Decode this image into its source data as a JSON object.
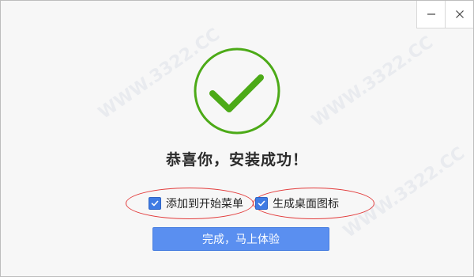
{
  "window": {
    "minimize_label": "—",
    "close_label": "✕"
  },
  "icons": {
    "success": "check-circle-icon",
    "checkbox": "checkmark-icon"
  },
  "colors": {
    "success_green": "#4caa17",
    "accent_blue": "#5a8ff0",
    "checkbox_blue": "#3f7be3",
    "annotation_red": "#e23a3a"
  },
  "main": {
    "headline": "恭喜你，安装成功！",
    "options": [
      {
        "label": "添加到开始菜单",
        "checked": true
      },
      {
        "label": "生成桌面图标",
        "checked": true
      }
    ],
    "finish_label": "完成，马上体验"
  }
}
